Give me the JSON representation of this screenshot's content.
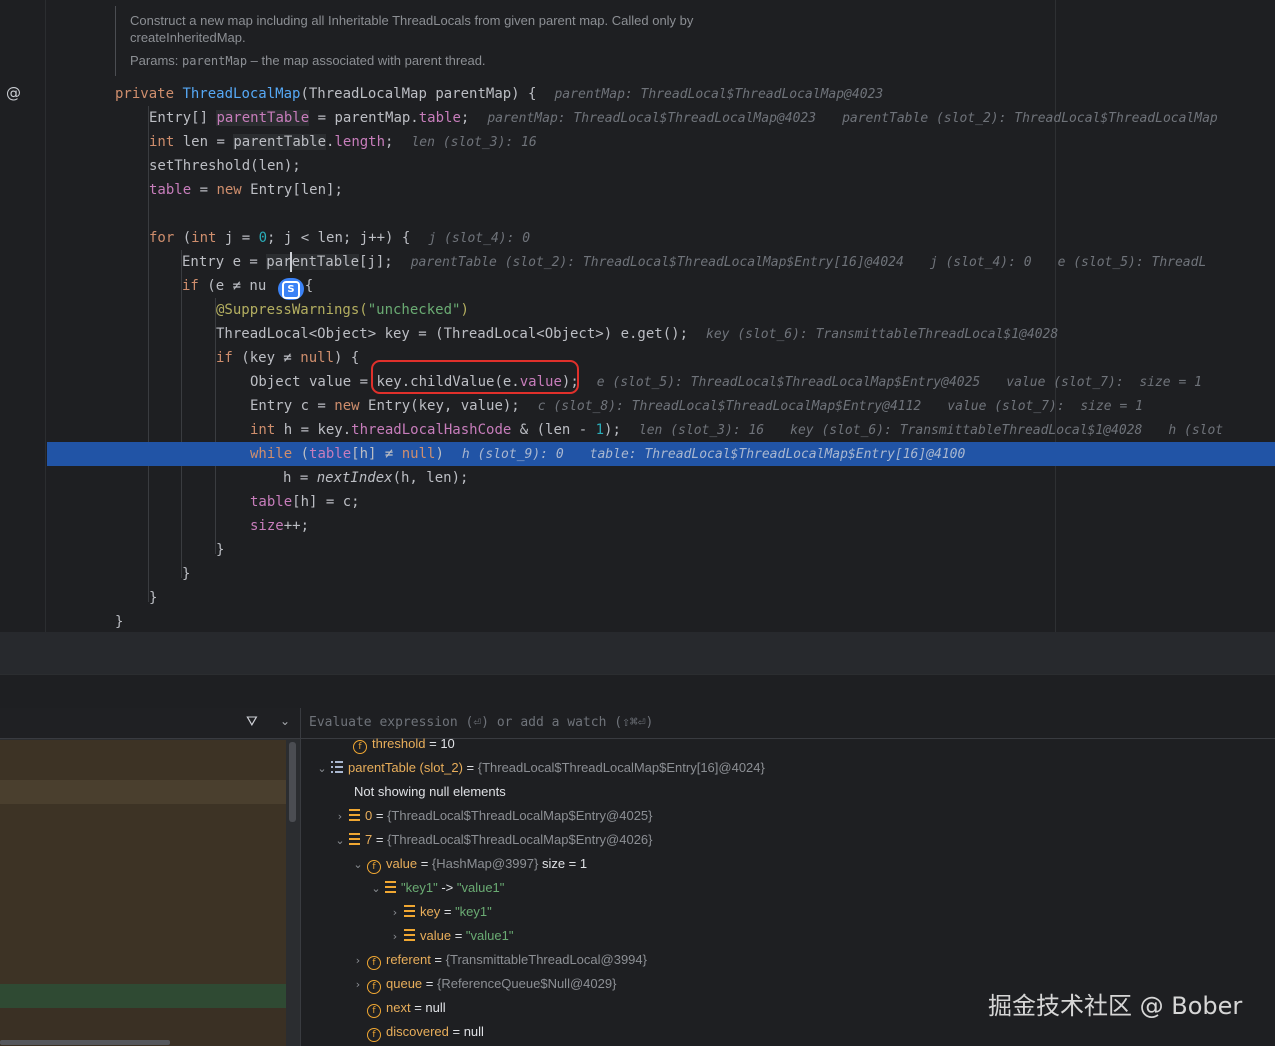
{
  "doc": {
    "text": "Construct a new map including all Inheritable ThreadLocals from given parent map. Called only by createInheritedMap.",
    "params_label": "Params:",
    "params_code": "parentMap",
    "params_desc": " – the map associated with parent thread."
  },
  "gutter": {
    "override_icon": "@"
  },
  "code": {
    "l1_a": "private ",
    "l1_b": "ThreadLocalMap",
    "l1_c": "(ThreadLocalMap parentMap) {",
    "l1_hint": "parentMap: ThreadLocal$ThreadLocalMap@4023",
    "l2_a": "Entry[] ",
    "l2_b": "parentTable",
    "l2_c": " = parentMap.",
    "l2_d": "table",
    "l2_e": ";",
    "l2_hint1": "parentMap: ThreadLocal$ThreadLocalMap@4023",
    "l2_hint2": "parentTable (slot_2): ThreadLocal$ThreadLocalMap",
    "l3_a": "int",
    "l3_b": " len = ",
    "l3_c": "parentTable",
    "l3_d": ".",
    "l3_e": "length",
    "l3_f": ";",
    "l3_hint": "len (slot_3): 16",
    "l4_a": "setThreshold(len);",
    "l5_a": "table",
    "l5_b": " = ",
    "l5_c": "new",
    "l5_d": " Entry[len];",
    "l6_a": "for",
    "l6_b": " (",
    "l6_c": "int",
    "l6_d": " j = ",
    "l6_e": "0",
    "l6_f": "; j < len; j++) {",
    "l6_hint": "j (slot_4): 0",
    "l7_a": "Entry e = ",
    "l7_b": "parentTable",
    "l7_c": "[j];",
    "l7_hint1": "parentTable (slot_2): ThreadLocal$ThreadLocalMap$Entry[16]@4024",
    "l7_hint2": "j (slot_4): 0",
    "l7_hint3": "e (slot_5): ThreadL",
    "l8_a": "if",
    "l8_b": " (e ≠ nu",
    "l8_c": " {",
    "l9_a": "@SuppressWarnings(",
    "l9_b": "\"unchecked\"",
    "l9_c": ")",
    "l10_a": "ThreadLocal<Object> key = (ThreadLocal<Object>) e.get();",
    "l10_hint": "key (slot_6): TransmittableThreadLocal$1@4028",
    "l11_a": "if",
    "l11_b": " (key ≠ ",
    "l11_c": "null",
    "l11_d": ") {",
    "l12_a": "Object value = ",
    "l12_b": "key.childValue(e.",
    "l12_c": "value",
    "l12_d": ");",
    "l12_hint1": "e (slot_5): ThreadLocal$ThreadLocalMap$Entry@4025",
    "l12_hint2": "value (slot_7):  size = 1",
    "l13_a": "Entry c = ",
    "l13_b": "new",
    "l13_c": " Entry(key, value);",
    "l13_hint1": "c (slot_8): ThreadLocal$ThreadLocalMap$Entry@4112",
    "l13_hint2": "value (slot_7):  size = 1",
    "l14_a": "int",
    "l14_b": " h = key.",
    "l14_c": "threadLocalHashCode",
    "l14_d": " & (len - ",
    "l14_e": "1",
    "l14_f": ");",
    "l14_hint1": "len (slot_3): 16",
    "l14_hint2": "key (slot_6): TransmittableThreadLocal$1@4028",
    "l14_hint3": "h (slot",
    "l15_a": "while",
    "l15_b": " (",
    "l15_c": "table",
    "l15_d": "[h] ≠ ",
    "l15_e": "null",
    "l15_f": ")",
    "l15_hint1": "h (slot_9): 0",
    "l15_hint2": "table: ThreadLocal$ThreadLocalMap$Entry[16]@4100",
    "l16_a": "h = ",
    "l16_b": "nextIndex",
    "l16_c": "(h, len);",
    "l17_a": "table",
    "l17_b": "[h] = c;",
    "l18_a": "size",
    "l18_b": "++;",
    "close": "}"
  },
  "badge": {
    "label": "S"
  },
  "debugger": {
    "watch_placeholder": "Evaluate expression (⏎) or add a watch (⇧⌘⏎)",
    "rows": {
      "threshold_name": "threshold",
      "threshold_eq": " = ",
      "threshold_val": "10",
      "parentTable_name": "parentTable (slot_2)",
      "parentTable_eq": " = ",
      "parentTable_val": "{ThreadLocal$ThreadLocalMap$Entry[16]@4024}",
      "not_showing": "Not showing null elements",
      "i0_name": "0",
      "i0_eq": " = ",
      "i0_val": "{ThreadLocal$ThreadLocalMap$Entry@4025}",
      "i7_name": "7",
      "i7_eq": " = ",
      "i7_val": "{ThreadLocal$ThreadLocalMap$Entry@4026}",
      "value_name": "value",
      "value_eq": " = ",
      "value_val": "{HashMap@3997}",
      "value_size": "  size = 1",
      "entry_key": "\"key1\"",
      "entry_arrow": " -> ",
      "entry_val": "\"value1\"",
      "key_name": "key",
      "key_eq": " = ",
      "key_val": "\"key1\"",
      "val_name": "value",
      "val_eq": " = ",
      "val_val": "\"value1\"",
      "referent_name": "referent",
      "referent_eq": " = ",
      "referent_val": "{TransmittableThreadLocal@3994}",
      "queue_name": "queue",
      "queue_eq": " = ",
      "queue_val": "{ReferenceQueue$Null@4029}",
      "next_name": "next",
      "next_eq": " = ",
      "next_val": "null",
      "discovered_name": "discovered",
      "discovered_eq": " = ",
      "discovered_val": "null"
    }
  },
  "watermark": "掘金技术社区 @ Bober",
  "colors": {
    "highlight": "#2154a6",
    "red_box": "#e0302b",
    "badge": "#3b82f6",
    "field_icon": "#f0a732"
  },
  "icons": [
    "override-icon",
    "filter-icon",
    "chevron-down-icon",
    "field-icon",
    "array-icon",
    "list-icon",
    "expand-arrow-icon",
    "collapse-arrow-icon"
  ]
}
